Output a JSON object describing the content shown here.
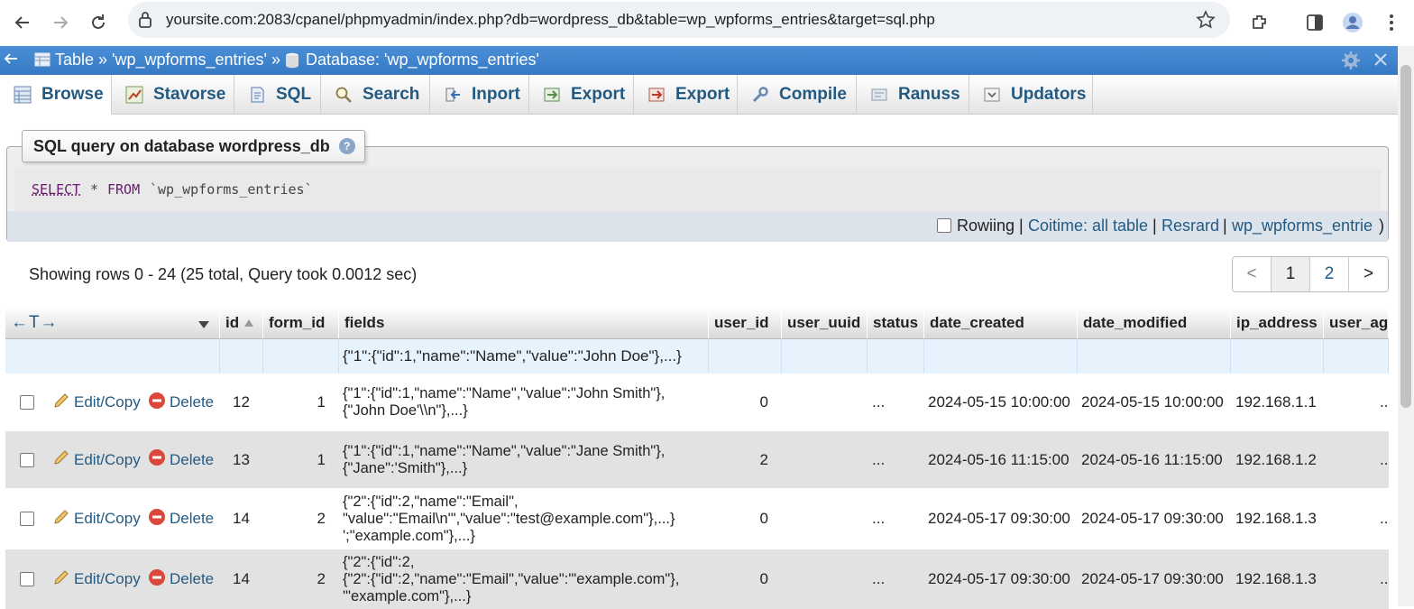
{
  "browser": {
    "url": "yoursite.com:2083/cpanel/phpmyadmin/index.php?db=wordpress_db&table=wp_wpforms_entries&target=sql.php"
  },
  "header": {
    "table_crumb": "Table » 'wp_wpforms_entries' »",
    "db_crumb": "Database: 'wp_wpforms_entries'"
  },
  "tabs": [
    {
      "label": "Browse",
      "icon": "browse-icon"
    },
    {
      "label": "Stavorse",
      "icon": "structure-icon"
    },
    {
      "label": "SQL",
      "icon": "sql-icon"
    },
    {
      "label": "Search",
      "icon": "search-icon"
    },
    {
      "label": "Inport",
      "icon": "import-icon"
    },
    {
      "label": "Export",
      "icon": "export-icon"
    },
    {
      "label": "Export",
      "icon": "export-icon"
    },
    {
      "label": "Compile",
      "icon": "wrench-icon"
    },
    {
      "label": "Ranuss",
      "icon": "operations-icon"
    },
    {
      "label": "Updators",
      "icon": "triggers-icon"
    }
  ],
  "sql": {
    "legend": "SQL query on database wordpress_db",
    "help": "?",
    "kw_select": "SELECT",
    "star": "*",
    "kw_from": "FROM",
    "table": "`wp_wpforms_entries`",
    "profiling_label": "Rowiing",
    "sep": "|",
    "link_inline": "Coitime: all table",
    "link_refresh": "Resrard",
    "link_table": "wp_wpforms_entrie",
    "close_paren": ")"
  },
  "summary": "Showing rows 0 - 24 (25 total, Query took 0.0012 sec)",
  "pager": {
    "prev": "<",
    "pages": [
      "1",
      "2"
    ],
    "next": ">"
  },
  "table": {
    "arrows": "←T→",
    "columns": [
      "id",
      "form_id",
      "fields",
      "user_id",
      "user_uuid",
      "status",
      "date_created",
      "date_modified",
      "ip_address",
      "user_ag"
    ],
    "filter_fields": "{\"1\":{\"id\":1,\"name\":\"Name\",\"value\":\"John Doe\"},...}",
    "edit_label": "Edit/Copy",
    "delete_label": "Delete",
    "rows": [
      {
        "id": "12",
        "form_id": "1",
        "fields": "{\"1\":{\"id\":1,\"name\":\"Name\",\"value\":\"John Smith\"},\n{\"John Doe'\\\\n\"},...}",
        "user_id": "0",
        "status": "...",
        "date_created": "2024-05-15 10:00:00",
        "date_modified": "2024-05-15 10:00:00",
        "ip_address": "192.168.1.1",
        "user_ag": ".."
      },
      {
        "id": "13",
        "form_id": "1",
        "fields": "{\"1\":{\"id\":1,\"name\":\"Name\",\"value\":\"Jane Smith\"},\n{\"Jane\":'Smith\"},...}",
        "user_id": "2",
        "status": "...",
        "date_created": "2024-05-16 11:15:00",
        "date_modified": "2024-05-16 11:15:00",
        "ip_address": "192.168.1.2",
        "user_ag": ".."
      },
      {
        "id": "14",
        "form_id": "2",
        "fields": "{\"2\":{\"id\":2,\"name\":\"Email\",\n\"value\":\"Email\\n'\",\"value\":\"test@example.com\"},...}\n';\"example.com\"},...}",
        "user_id": "0",
        "status": "...",
        "date_created": "2024-05-17 09:30:00",
        "date_modified": "2024-05-17 09:30:00",
        "ip_address": "192.168.1.3",
        "user_ag": ".."
      },
      {
        "id": "14",
        "form_id": "2",
        "fields": "{\"2\":{\"id\":2,\n{\"2\":{\"id\":2,\"name\":\"Email\",\"value\":'\"example.com\"},\n'\"example.com\"},...}",
        "user_id": "0",
        "status": "...",
        "date_created": "2024-05-17 09:30:00",
        "date_modified": "2024-05-17 09:30:00",
        "ip_address": "192.168.1.3",
        "user_ag": ".."
      }
    ]
  }
}
